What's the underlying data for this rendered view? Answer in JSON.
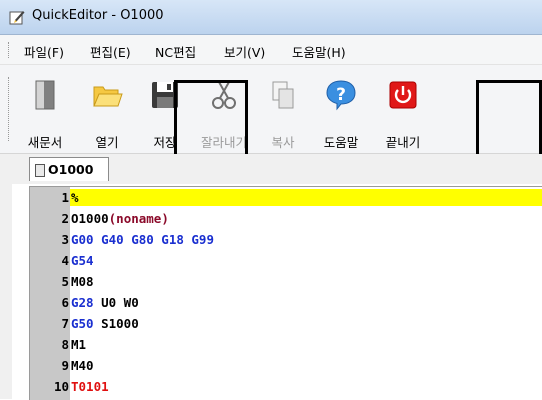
{
  "window": {
    "title": "QuickEditor - O1000"
  },
  "menu": [
    {
      "label": "파일(F)"
    },
    {
      "label": "편집(E)"
    },
    {
      "label": "NC편집"
    },
    {
      "label": "보기(V)"
    },
    {
      "label": "도움말(H)"
    }
  ],
  "toolbar": [
    {
      "label": "새문서",
      "icon": "new-document-icon",
      "enabled": true,
      "highlighted": false
    },
    {
      "label": "열기",
      "icon": "open-folder-icon",
      "enabled": true,
      "highlighted": false
    },
    {
      "label": "저장",
      "icon": "save-icon",
      "enabled": true,
      "highlighted": true
    },
    {
      "label": "잘라내기",
      "icon": "scissors-icon",
      "enabled": false,
      "highlighted": false
    },
    {
      "label": "복사",
      "icon": "copy-icon",
      "enabled": false,
      "highlighted": false
    },
    {
      "label": "도움말",
      "icon": "help-icon",
      "enabled": true,
      "highlighted": false
    },
    {
      "label": "끝내기",
      "icon": "power-icon",
      "enabled": true,
      "highlighted": true
    }
  ],
  "tabs": [
    {
      "label": "O1000",
      "active": true
    }
  ],
  "editor": {
    "current_line": 1,
    "colors": {
      "current_line_bg": "#ffff00",
      "gutter_bg": "#c8c8c8",
      "gcode": "#1a2fd0",
      "comment": "#8b0a2a",
      "tool": "#e01010"
    },
    "lines": [
      {
        "num": "1",
        "tokens": [
          {
            "text": "%",
            "color": "black"
          }
        ]
      },
      {
        "num": "2",
        "tokens": [
          {
            "text": "O1000",
            "color": "black"
          },
          {
            "text": "(noname)",
            "color": "maroon"
          }
        ]
      },
      {
        "num": "3",
        "tokens": [
          {
            "text": "G00 G40 G80 G18 G99",
            "color": "blue"
          }
        ]
      },
      {
        "num": "4",
        "tokens": [
          {
            "text": "G54",
            "color": "blue"
          }
        ]
      },
      {
        "num": "5",
        "tokens": [
          {
            "text": "M08",
            "color": "black"
          }
        ]
      },
      {
        "num": "6",
        "tokens": [
          {
            "text": "G28",
            "color": "blue"
          },
          {
            "text": " U0 W0",
            "color": "black"
          }
        ]
      },
      {
        "num": "7",
        "tokens": [
          {
            "text": "G50",
            "color": "blue"
          },
          {
            "text": " S1000",
            "color": "black"
          }
        ]
      },
      {
        "num": "8",
        "tokens": [
          {
            "text": "M1",
            "color": "black"
          }
        ]
      },
      {
        "num": "9",
        "tokens": [
          {
            "text": "M40",
            "color": "black"
          }
        ]
      },
      {
        "num": "10",
        "tokens": [
          {
            "text": "T0101",
            "color": "red"
          }
        ]
      }
    ]
  }
}
